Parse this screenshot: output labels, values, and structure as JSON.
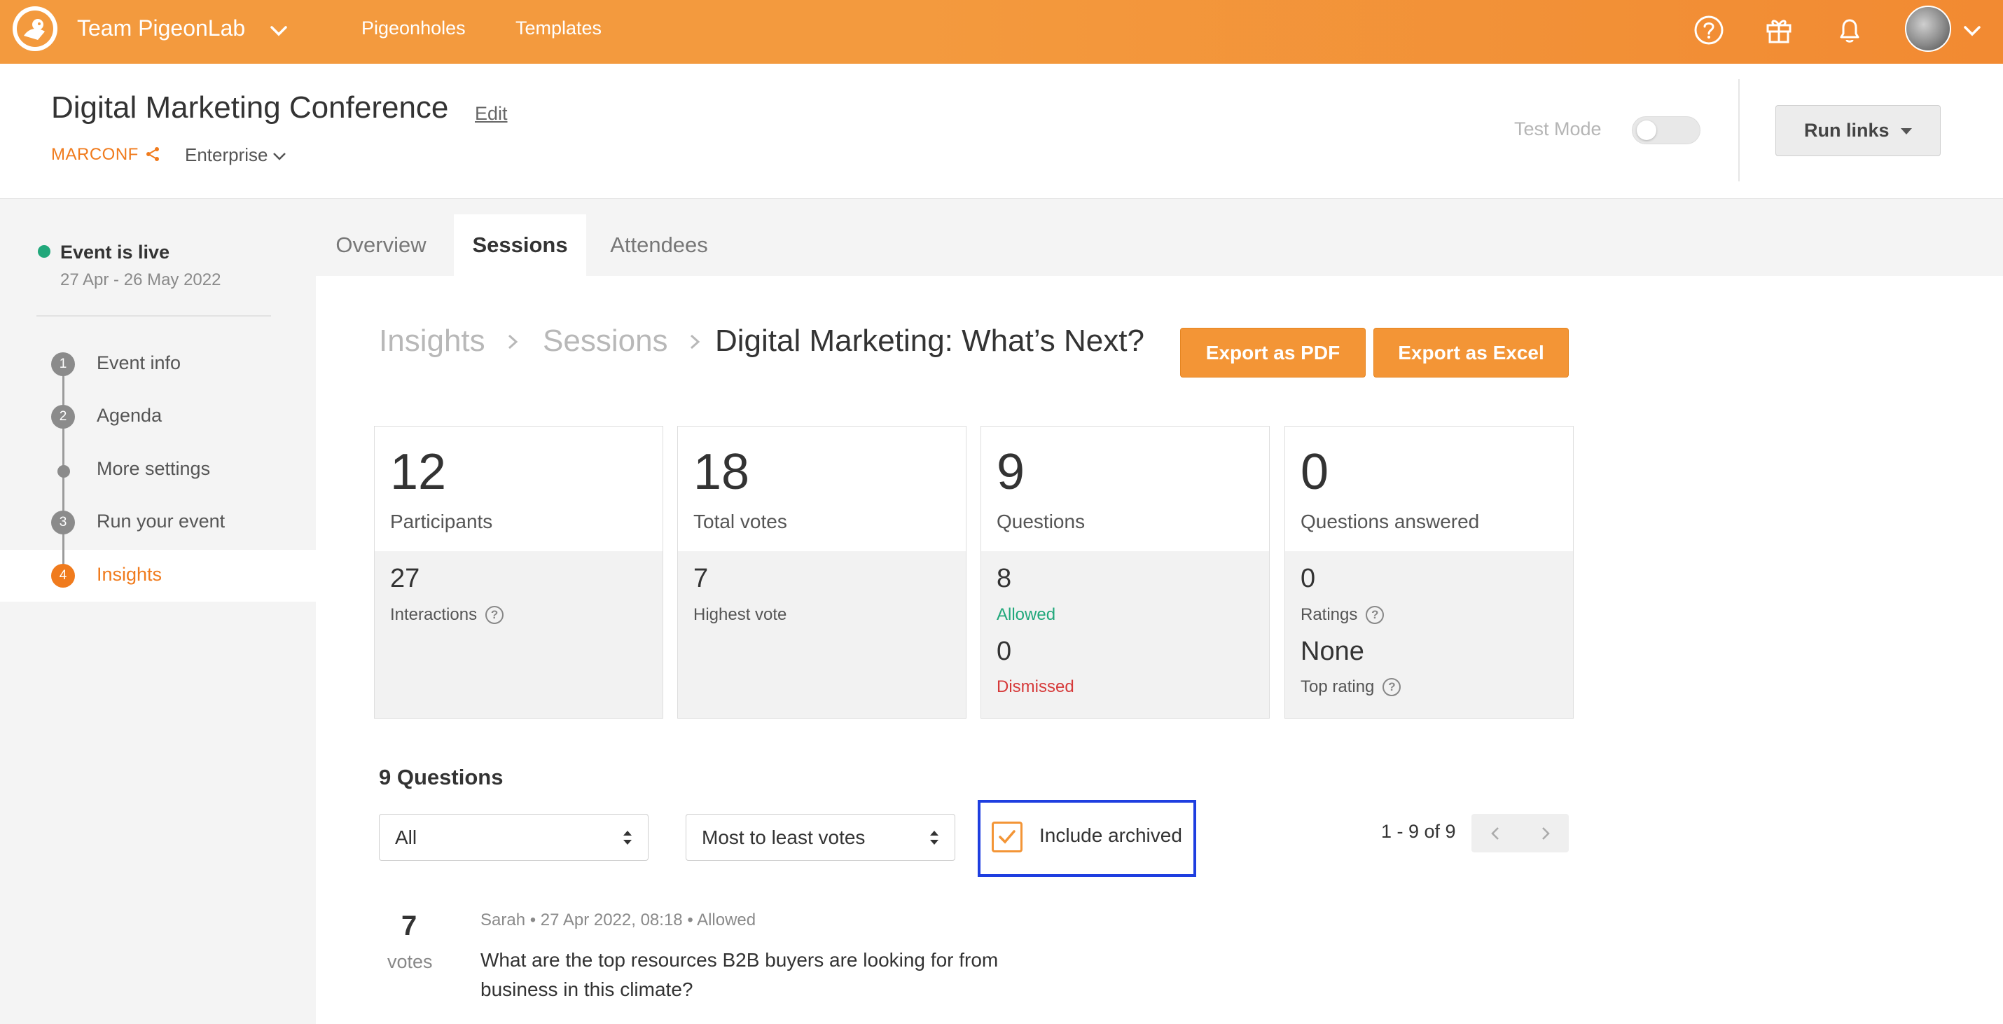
{
  "topbar": {
    "team_name": "Team PigeonLab",
    "nav": [
      "Pigeonholes",
      "Templates"
    ],
    "icons": [
      "help-icon",
      "gift-icon",
      "bell-icon"
    ]
  },
  "header": {
    "event_title": "Digital Marketing Conference",
    "edit_label": "Edit",
    "event_code": "MARCONF",
    "plan": "Enterprise",
    "test_mode_label": "Test Mode",
    "test_mode_on": false,
    "run_links_label": "Run links"
  },
  "sidebar": {
    "status": "Event is live",
    "dates": "27 Apr - 26 May 2022",
    "steps": [
      {
        "num": "1",
        "label": "Event info"
      },
      {
        "num": "2",
        "label": "Agenda"
      },
      {
        "num": "",
        "label": "More settings"
      },
      {
        "num": "3",
        "label": "Run your event"
      },
      {
        "num": "4",
        "label": "Insights"
      }
    ]
  },
  "tabs": [
    "Overview",
    "Sessions",
    "Attendees"
  ],
  "breadcrumb": [
    "Insights",
    "Sessions",
    "Digital Marketing: What’s Next?"
  ],
  "actions": {
    "export_pdf": "Export as PDF",
    "export_excel": "Export as Excel"
  },
  "stats": [
    {
      "value": "12",
      "label": "Participants",
      "sub_value": "27",
      "sub_label": "Interactions"
    },
    {
      "value": "18",
      "label": "Total votes",
      "sub_value": "7",
      "sub_label": "Highest vote"
    },
    {
      "value": "9",
      "label": "Questions",
      "sub_value": "8",
      "sub_label": "Allowed",
      "sub_value2": "0",
      "sub_label2": "Dismissed"
    },
    {
      "value": "0",
      "label": "Questions answered",
      "sub_value": "0",
      "sub_label": "Ratings",
      "sub_value2": "None",
      "sub_label2": "Top rating"
    }
  ],
  "questions": {
    "heading": "9 Questions",
    "filter_value": "All",
    "sort_value": "Most to least votes",
    "include_archived_label": "Include archived",
    "include_archived_checked": true,
    "pagination": "1 - 9 of 9",
    "items": [
      {
        "votes": "7",
        "votes_label": "votes",
        "author": "Sarah",
        "time": "27 Apr 2022, 08:18",
        "status": "Allowed",
        "text": "What are the top resources B2B buyers are looking for from business in this climate?"
      }
    ]
  },
  "colors": {
    "brand_orange": "#f39536",
    "live_green": "#21a87b",
    "dismissed_red": "#d63a3a",
    "highlight_blue": "#1e3ee0"
  }
}
